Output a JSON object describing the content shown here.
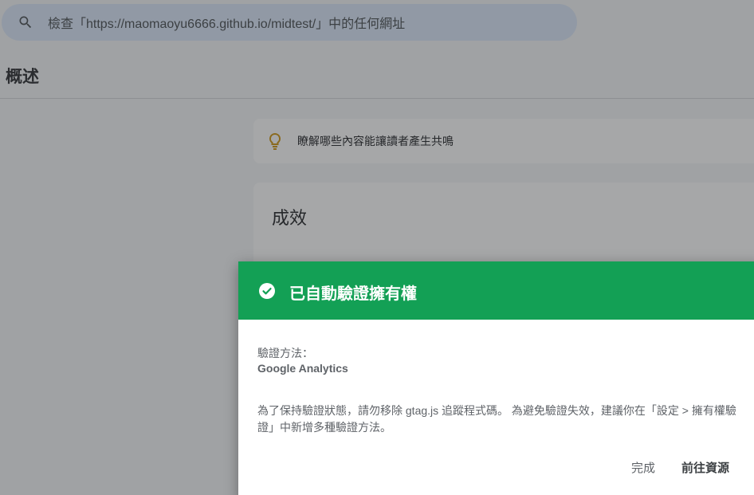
{
  "search": {
    "placeholder": "檢查「https://maomaoyu6666.github.io/midtest/」中的任何網址"
  },
  "page": {
    "title": "概述"
  },
  "tip": {
    "text": "瞭解哪些內容能讓讀者產生共鳴"
  },
  "performance": {
    "title": "成效"
  },
  "dialog": {
    "title": "已自動驗證擁有權",
    "method_label": "驗證方法：",
    "method_value": "Google Analytics",
    "note": "為了保持驗證狀態，請勿移除 gtag.js 追蹤程式碼。 為避免驗證失效，建議你在「設定 > 擁有權驗證」中新增多種驗證方法。",
    "done_label": "完成",
    "go_label": "前往資源",
    "header_color": "#13a055"
  },
  "icons": {
    "search": "search-icon",
    "tip": "lightbulb-icon",
    "success": "check-circle-icon"
  }
}
